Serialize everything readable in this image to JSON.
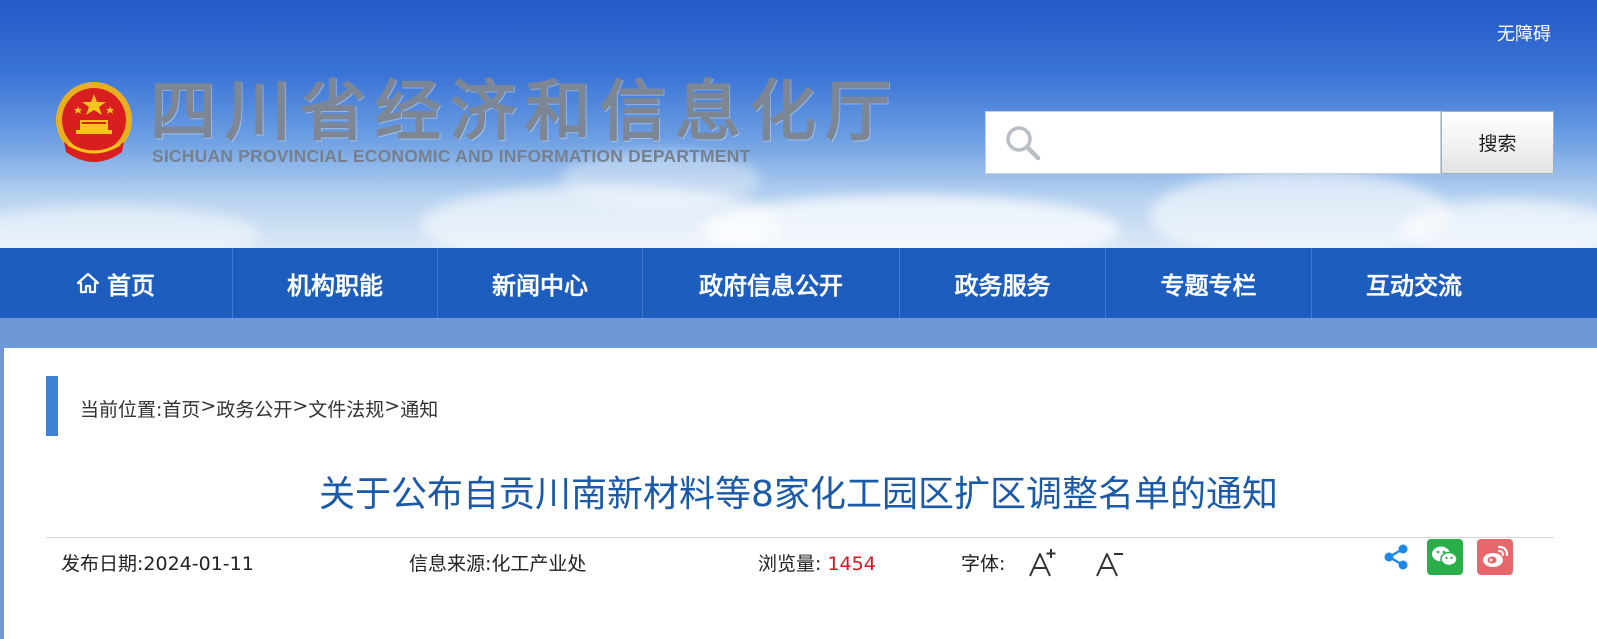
{
  "header": {
    "accessibility_label": "无障碍",
    "title_cn": "四川省经济和信息化厅",
    "title_en": "SICHUAN PROVINCIAL ECONOMIC AND INFORMATION DEPARTMENT",
    "emblem_icon": "national-emblem-icon",
    "search": {
      "placeholder": "",
      "value": "",
      "button_label": "搜索",
      "icon": "search-icon"
    },
    "colors": {
      "banner_top": "#2458c8",
      "banner_bottom": "#dbe8f6"
    }
  },
  "nav": {
    "background": "#1c5dbd",
    "items": [
      {
        "label": "首页",
        "icon": "home-icon"
      },
      {
        "label": "机构职能"
      },
      {
        "label": "新闻中心"
      },
      {
        "label": "政府信息公开"
      },
      {
        "label": "政务服务"
      },
      {
        "label": "专题专栏"
      },
      {
        "label": "互动交流"
      }
    ]
  },
  "breadcrumb": {
    "prefix": "当前位置: ",
    "items": [
      "首页",
      "政务公开",
      "文件法规",
      "通知"
    ],
    "separator": ">"
  },
  "article": {
    "title": "关于公布自贡川南新材料等8家化工园区扩区调整名单的通知",
    "title_color": "#1a5aa8",
    "publish_date_label": "发布日期:",
    "publish_date": "2024-01-11",
    "source_label": "信息来源:",
    "source": "化工产业处",
    "views_label": "浏览量: ",
    "views": "1454",
    "views_color": "#d8141e",
    "font_label": "字体:",
    "font_increase_icon": "font-increase-icon",
    "font_decrease_icon": "font-decrease-icon"
  },
  "share": {
    "share_icon": "share-icon",
    "wechat_icon": "wechat-icon",
    "weibo_icon": "weibo-icon",
    "colors": {
      "share": "#1e88e5",
      "wechat": "#2aae4a",
      "weibo": "#e8676b"
    }
  }
}
